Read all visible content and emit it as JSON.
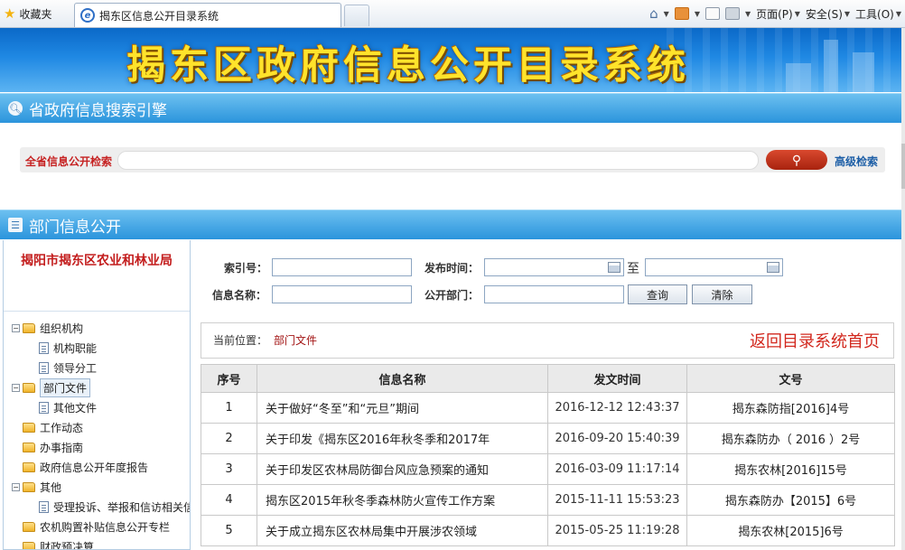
{
  "browser": {
    "favorites_label": "收藏夹",
    "tab_title": "揭东区信息公开目录系统",
    "menu": [
      "页面(P)",
      "安全(S)",
      "工具(O)"
    ]
  },
  "banner": {
    "title": "揭东区政府信息公开目录系统"
  },
  "search_section": {
    "heading": "省政府信息搜索引擎",
    "label": "全省信息公开检索",
    "input_value": "",
    "advanced_link": "高级检索"
  },
  "dept_section": {
    "heading": "部门信息公开"
  },
  "sidebar": {
    "dept_name": "揭阳市揭东区农业和林业局",
    "tree": [
      {
        "label": "组织机构",
        "level": 1,
        "type": "folder",
        "toggle": "-"
      },
      {
        "label": "机构职能",
        "level": 2,
        "type": "file"
      },
      {
        "label": "领导分工",
        "level": 2,
        "type": "file"
      },
      {
        "label": "部门文件",
        "level": 1,
        "type": "folder",
        "toggle": "-",
        "selected": true
      },
      {
        "label": "其他文件",
        "level": 2,
        "type": "file"
      },
      {
        "label": "工作动态",
        "level": 1,
        "type": "folder",
        "toggle": ""
      },
      {
        "label": "办事指南",
        "level": 1,
        "type": "folder",
        "toggle": ""
      },
      {
        "label": "政府信息公开年度报告",
        "level": 1,
        "type": "folder",
        "toggle": ""
      },
      {
        "label": "其他",
        "level": 1,
        "type": "folder",
        "toggle": "-"
      },
      {
        "label": "受理投诉、举报和信访相关信",
        "level": 2,
        "type": "file"
      },
      {
        "label": "农机购置补贴信息公开专栏",
        "level": 1,
        "type": "folder",
        "toggle": ""
      },
      {
        "label": "财政预决算",
        "level": 1,
        "type": "folder",
        "toggle": ""
      }
    ]
  },
  "filters": {
    "index_label": "索引号：",
    "index_value": "",
    "date_label": "发布时间：",
    "date_from": "",
    "date_sep": "至",
    "date_to": "",
    "name_label": "信息名称：",
    "name_value": "",
    "dept_label": "公开部门：",
    "dept_value": "",
    "query_button": "查询",
    "clear_button": "清除"
  },
  "location": {
    "label": "当前位置：",
    "value": "部门文件",
    "back_link": "返回目录系统首页"
  },
  "table": {
    "headers": [
      "序号",
      "信息名称",
      "发文时间",
      "文号"
    ],
    "rows": [
      [
        "1",
        "关于做好“冬至”和“元旦”期间",
        "2016-12-12 12:43:37",
        "揭东森防指[2016]4号"
      ],
      [
        "2",
        "关于印发《揭东区2016年秋冬季和2017年",
        "2016-09-20 15:40:39",
        "揭东森防办（ 2016 ）2号"
      ],
      [
        "3",
        "关于印发区农林局防御台风应急预案的通知",
        "2016-03-09 11:17:14",
        "揭东农林[2016]15号"
      ],
      [
        "4",
        "揭东区2015年秋冬季森林防火宣传工作方案",
        "2015-11-11 15:53:23",
        "揭东森防办【2015】6号"
      ],
      [
        "5",
        "关于成立揭东区农林局集中开展涉农领域",
        "2015-05-25 11:19:28",
        "揭东农林[2015]6号"
      ]
    ]
  }
}
